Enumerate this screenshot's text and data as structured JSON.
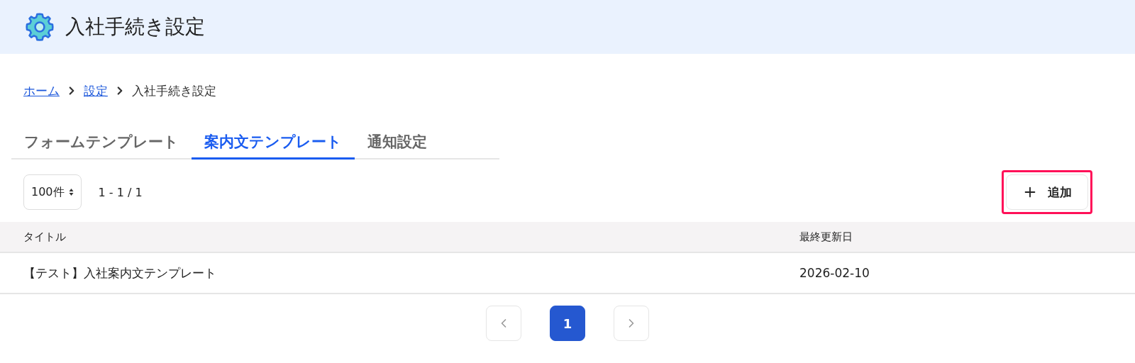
{
  "header": {
    "title": "入社手続き設定"
  },
  "breadcrumb": [
    {
      "label": "ホーム",
      "kind": "link"
    },
    {
      "label": "設定",
      "kind": "link"
    },
    {
      "label": "入社手続き設定",
      "kind": "current"
    }
  ],
  "tabs": [
    {
      "label": "フォームテンプレート",
      "selected": false
    },
    {
      "label": "案内文テンプレート",
      "selected": true
    },
    {
      "label": "通知設定",
      "selected": false
    }
  ],
  "toolbar": {
    "page_size": "100件",
    "range": "1 - 1 / 1",
    "add_button": {
      "label": "追加",
      "highlighted": true
    }
  },
  "table": {
    "columns": [
      "タイトル",
      "最終更新日"
    ],
    "rows": [
      [
        "【テスト】入社案内文テンプレート",
        "2026-02-10"
      ]
    ]
  },
  "pagination": {
    "pages": [
      {
        "label": "1",
        "selected": true
      }
    ],
    "prev_disabled": true,
    "next_disabled": true
  }
}
